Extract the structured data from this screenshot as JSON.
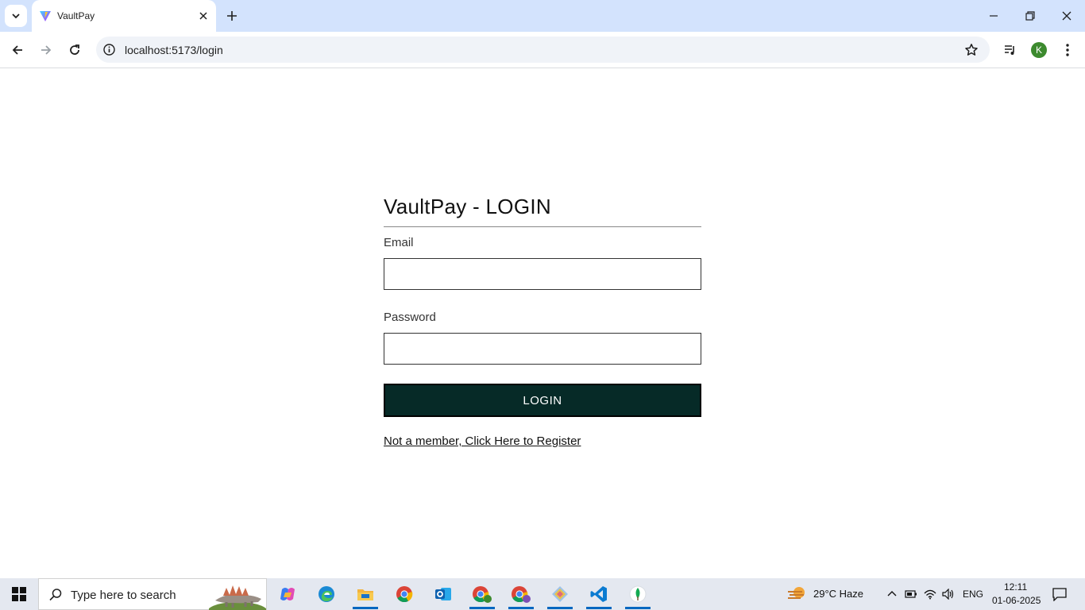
{
  "browser": {
    "tab_title": "VaultPay",
    "url": "localhost:5173/login",
    "profile_initial": "K"
  },
  "login": {
    "title": "VaultPay - LOGIN",
    "email_label": "Email",
    "email_value": "",
    "password_label": "Password",
    "password_value": "",
    "button_label": "LOGIN",
    "register_link": "Not a member, Click Here to Register"
  },
  "taskbar": {
    "search_placeholder": "Type here to search",
    "weather": "29°C  Haze",
    "language": "ENG",
    "time": "12:11",
    "date": "01-06-2025"
  },
  "colors": {
    "tabstrip_bg": "#d3e3fd",
    "login_button_bg": "#062a27",
    "avatar_bg": "#3c8a2e"
  }
}
